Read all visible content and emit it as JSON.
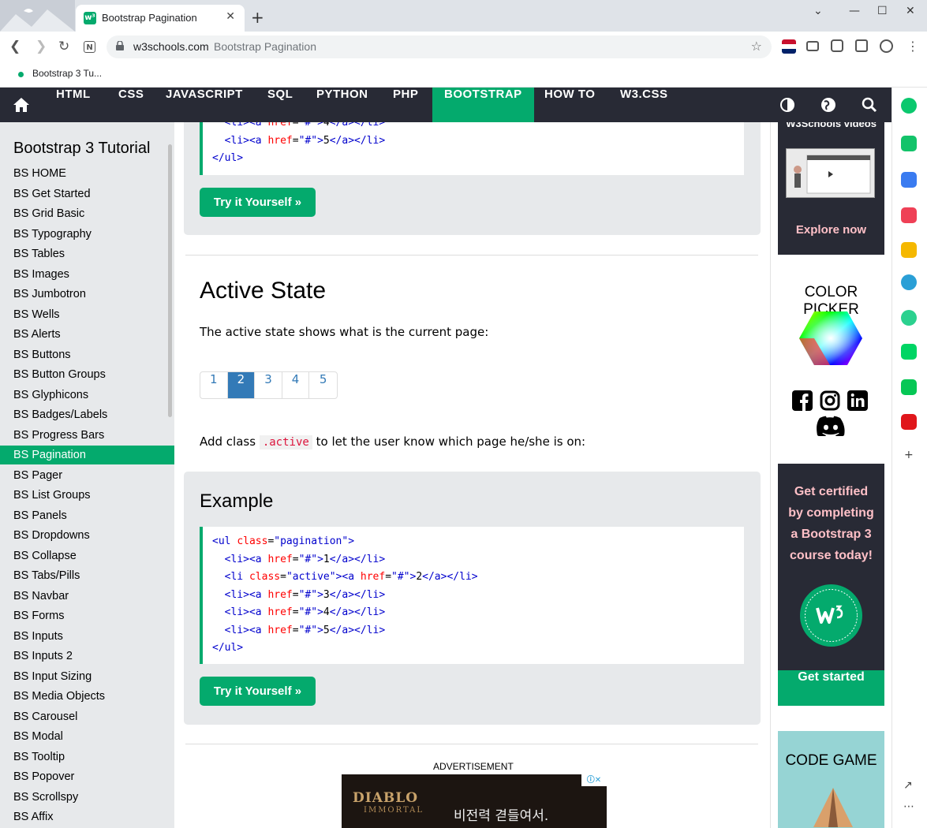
{
  "browser": {
    "tab_title": "Bootstrap Pagination",
    "tab_close": "✕",
    "new_tab": "+",
    "url_host": "w3schools.com",
    "url_path": "Bootstrap Pagination",
    "bookmark": "Bootstrap 3 Tu...",
    "window_controls": [
      "⌄",
      "—",
      "☐",
      "✕"
    ]
  },
  "topnav": {
    "items": [
      "HTML",
      "CSS",
      "JAVASCRIPT",
      "SQL",
      "PYTHON",
      "PHP",
      "BOOTSTRAP",
      "HOW TO",
      "W3.CSS"
    ],
    "active": "BOOTSTRAP"
  },
  "sidebar": {
    "title": "Bootstrap 3 Tutorial",
    "links": [
      "BS HOME",
      "BS Get Started",
      "BS Grid Basic",
      "BS Typography",
      "BS Tables",
      "BS Images",
      "BS Jumbotron",
      "BS Wells",
      "BS Alerts",
      "BS Buttons",
      "BS Button Groups",
      "BS Glyphicons",
      "BS Badges/Labels",
      "BS Progress Bars",
      "BS Pagination",
      "BS Pager",
      "BS List Groups",
      "BS Panels",
      "BS Dropdowns",
      "BS Collapse",
      "BS Tabs/Pills",
      "BS Navbar",
      "BS Forms",
      "BS Inputs",
      "BS Inputs 2",
      "BS Input Sizing",
      "BS Media Objects",
      "BS Carousel",
      "BS Modal",
      "BS Tooltip",
      "BS Popover",
      "BS Scrollspy",
      "BS Affix"
    ],
    "active": "BS Pagination"
  },
  "main": {
    "try_label": "Try it Yourself »",
    "section_title": "Active State",
    "intro": "The active state shows what is the current page:",
    "pagination": [
      "1",
      "2",
      "3",
      "4",
      "5"
    ],
    "pagination_active": "2",
    "add_class_before": "Add class ",
    "add_class_code": ".active",
    "add_class_after": " to let the user know which page he/she is on:",
    "example_title": "Example",
    "advertisement": "ADVERTISEMENT",
    "ad_logo": "DIABLO",
    "ad_sub": "IMMORTAL",
    "ad_text": "비전력 겯들여서.",
    "ad_badge": "ⓘ✕"
  },
  "right": {
    "videos_title": "W3Schools videos",
    "explore": "Explore now",
    "color_picker": "COLOR PICKER",
    "cert_line1": "Get certified",
    "cert_line2": "by completing",
    "cert_line3": "a Bootstrap 3",
    "cert_line4": "course today!",
    "get_started": "Get started",
    "code_game": "CODE GAME"
  },
  "colors": {
    "brand_green": "#04aa6d",
    "nav_dark": "#282a35",
    "pagination_blue": "#337ab7"
  }
}
